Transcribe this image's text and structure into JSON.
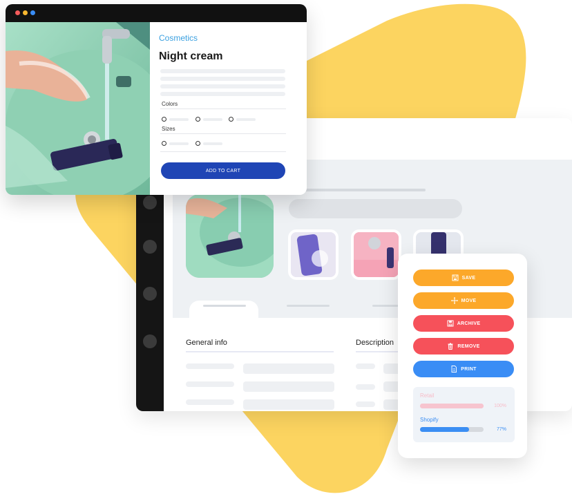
{
  "product": {
    "category": "Cosmetics",
    "title": "Night cream",
    "colors_label": "Colors",
    "sizes_label": "Sizes",
    "add_to_cart": "ADD TO CART"
  },
  "details": {
    "general_info": "General info",
    "description": "Description"
  },
  "actions": {
    "save": "SAVE",
    "move": "MOVE",
    "archive": "ARCHIVE",
    "remove": "REMOVE",
    "print": "PRINT"
  },
  "stats": [
    {
      "name": "Retail",
      "value_text": "100%",
      "fraction": 1.0
    },
    {
      "name": "Shopify",
      "value_text": "77%",
      "fraction": 0.77
    }
  ],
  "colors": {
    "yellow": "#fcd460",
    "primary_blue": "#1f45b5",
    "save": "#fca82a",
    "archive": "#f6515a",
    "print": "#3a8df5",
    "retail": "#f7c4cf",
    "shopify": "#3b8ef3"
  },
  "icons": [
    "save-icon",
    "move-icon",
    "archive-icon",
    "trash-icon",
    "document-icon"
  ]
}
